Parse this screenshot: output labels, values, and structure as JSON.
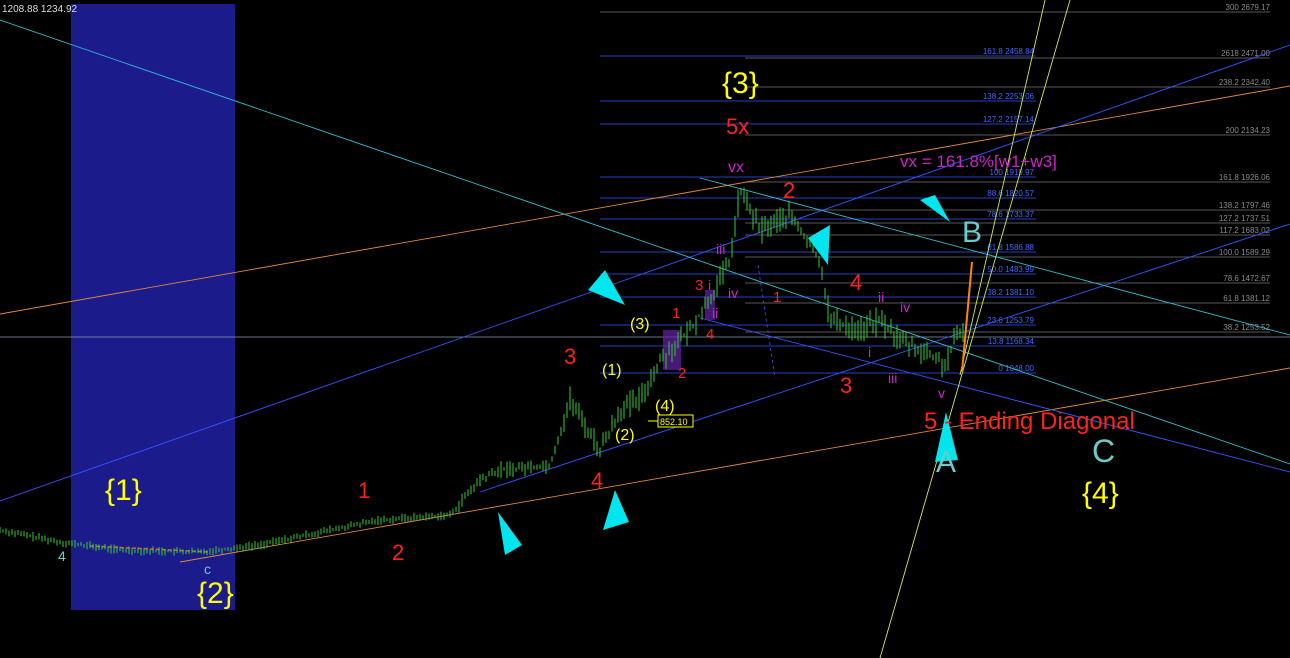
{
  "header": {
    "price_readout": "1208.88 1234.92"
  },
  "chart_data": {
    "type": "candlestick",
    "annotations": {
      "wave_1": "{1}",
      "wave_2": "{2}",
      "wave_3": "{3}",
      "wave_4": "{4}",
      "c_label": "C",
      "b_label": "B",
      "a_label": "A",
      "five_x": "5x",
      "vx": "vx",
      "vx_formula": "vx = 161.8%[w1+w3]",
      "ending_diagonal": "5 - Ending Diagonal",
      "price_tag": "852.10",
      "small_4_left": "4",
      "small_c": "c",
      "inner_1": "(1)",
      "inner_2": "(2)",
      "inner_3": "(3)",
      "inner_4": "(4)"
    },
    "red_labels": [
      {
        "id": "r1",
        "text": "1"
      },
      {
        "id": "r2",
        "text": "2"
      },
      {
        "id": "r3",
        "text": "3"
      },
      {
        "id": "r4",
        "text": "4"
      },
      {
        "id": "r1b",
        "text": "1"
      },
      {
        "id": "r2b",
        "text": "2"
      },
      {
        "id": "r3b",
        "text": "3"
      },
      {
        "id": "r4b",
        "text": "4"
      },
      {
        "id": "r1c",
        "text": "1"
      },
      {
        "id": "r2c",
        "text": "2"
      },
      {
        "id": "r3c",
        "text": "3"
      },
      {
        "id": "r4c",
        "text": "4"
      },
      {
        "id": "r2d",
        "text": "2"
      }
    ],
    "magenta_labels": [
      {
        "id": "m_i1",
        "text": "i"
      },
      {
        "id": "m_ii1",
        "text": "ii"
      },
      {
        "id": "m_iii1",
        "text": "iii"
      },
      {
        "id": "m_iv1",
        "text": "iv"
      },
      {
        "id": "m_i2",
        "text": "i"
      },
      {
        "id": "m_ii2",
        "text": "ii"
      },
      {
        "id": "m_iii2",
        "text": "iii"
      },
      {
        "id": "m_iv2",
        "text": "iv"
      },
      {
        "id": "m_v2",
        "text": "v"
      }
    ],
    "fib_mid": [
      {
        "label": "161.8 2458.84",
        "value": 2458.84
      },
      {
        "label": "138.2 2253.06",
        "value": 2253.06
      },
      {
        "label": "127.2 2157.14",
        "value": 2157.14
      },
      {
        "label": "100 1919.97",
        "value": 1919.97
      },
      {
        "label": "88.6 1820.57",
        "value": 1820.57
      },
      {
        "label": "78.6 1733.37",
        "value": 1733.37
      },
      {
        "label": "61.8 1586.88",
        "value": 1586.88
      },
      {
        "label": "50.0 1483.99",
        "value": 1483.99
      },
      {
        "label": "38.2 1381.10",
        "value": 1381.1
      },
      {
        "label": "23.6 1253.79",
        "value": 1253.79
      },
      {
        "label": "13.8 1168.34",
        "value": 1168.34
      },
      {
        "label": "0 1048.00",
        "value": 1048.0
      }
    ],
    "fib_right": [
      {
        "label": "300 2679.17",
        "value": 2679.17
      },
      {
        "label": "2618 2471.00",
        "value": 2471.0
      },
      {
        "label": "238.2 2342.40",
        "value": 2342.4
      },
      {
        "label": "200 2134.23",
        "value": 2134.23
      },
      {
        "label": "161.8 1926.06",
        "value": 1926.06
      },
      {
        "label": "138.2 1797.46",
        "value": 1797.46
      },
      {
        "label": "127.2 1737.51",
        "value": 1737.51
      },
      {
        "label": "117.2 1683.02",
        "value": 1683.02
      },
      {
        "label": "100.0 1589.29",
        "value": 1589.29
      },
      {
        "label": "78.6 1472.67",
        "value": 1472.67
      },
      {
        "label": "61.8 1381.12",
        "value": 1381.12
      },
      {
        "label": "38.2 1253.52",
        "value": 1253.52
      }
    ],
    "colors": {
      "background": "#000000",
      "candle": "#33cc33",
      "fib_mid": "#3355ff",
      "fib_right": "#777777",
      "fib_text_mid": "#4466ff",
      "fib_text_right": "#888888",
      "yellow": "#ffff00",
      "red": "#ff2020",
      "magenta": "#cc22cc",
      "cyan": "#00e5ee",
      "teal": "#66cccc",
      "blue_box": "#1b1b8c",
      "orange": "#e0883a",
      "trend_blue": "#3355ff",
      "trend_cyan": "#33bbcc",
      "trend_yellow": "#ccee55"
    }
  }
}
